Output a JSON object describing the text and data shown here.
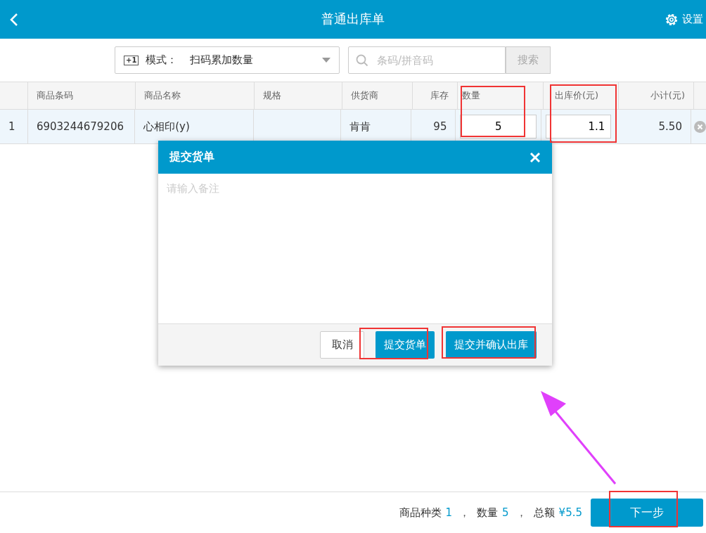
{
  "header": {
    "title": "普通出库单",
    "settings_label": "设置"
  },
  "toolbar": {
    "mode_badge": "+1",
    "mode_label": "模式：",
    "mode_value": "扫码累加数量",
    "search_placeholder": "条码/拼音码",
    "search_button": "搜索"
  },
  "table": {
    "columns": [
      "商品条码",
      "商品名称",
      "规格",
      "供货商",
      "库存",
      "数量",
      "出库价(元)",
      "小计(元)"
    ],
    "rows": [
      {
        "index": "1",
        "barcode": "6903244679206",
        "name": "心相印(y)",
        "supplier": "肯肯",
        "stock": "95",
        "quantity": "5",
        "price": "1.1",
        "subtotal": "5.50"
      }
    ]
  },
  "dialog": {
    "title": "提交货单",
    "placeholder": "请输入备注",
    "buttons": [
      {
        "label": "取消",
        "kind": "secondary"
      },
      {
        "label": "提交货单",
        "kind": "primary"
      },
      {
        "label": "提交并确认出库",
        "kind": "primary"
      }
    ]
  },
  "footer": {
    "summary": [
      {
        "label": "商品种类",
        "value": "1",
        "separator": "，"
      },
      {
        "label": "数量",
        "value": "5",
        "separator": "，"
      },
      {
        "label": "总额",
        "value": "¥5.5"
      }
    ],
    "next_button": "下一步"
  }
}
